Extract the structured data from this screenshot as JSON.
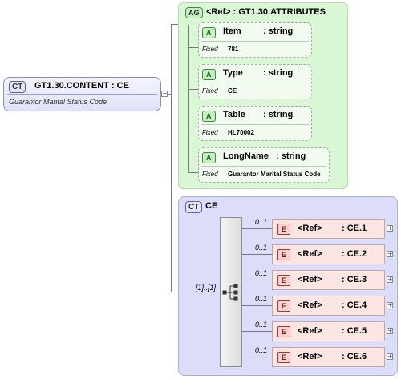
{
  "root": {
    "badge": "CT",
    "title": "GT1.30.CONTENT : CE",
    "description": "Guarantor Marital Status Code"
  },
  "attributes_group": {
    "badge": "AG",
    "title": "<Ref>      : GT1.30.ATTRIBUTES",
    "fixed_label": "Fixed",
    "items": [
      {
        "badge": "A",
        "name": "Item",
        "type": ": string",
        "fixed": "781"
      },
      {
        "badge": "A",
        "name": "Type",
        "type": ": string",
        "fixed": "CE"
      },
      {
        "badge": "A",
        "name": "Table",
        "type": ": string",
        "fixed": "HL70002"
      },
      {
        "badge": "A",
        "name": "LongName",
        "type": ": string",
        "fixed": "Guarantor Marital Status Code"
      }
    ]
  },
  "complex_type": {
    "badge": "CT",
    "title": "CE",
    "sequence_occurrence": "[1]..[1]",
    "elements": [
      {
        "badge": "E",
        "ref": "<Ref>",
        "type": ": CE.1",
        "occurrence": "0..1"
      },
      {
        "badge": "E",
        "ref": "<Ref>",
        "type": ": CE.2",
        "occurrence": "0..1"
      },
      {
        "badge": "E",
        "ref": "<Ref>",
        "type": ": CE.3",
        "occurrence": "0..1"
      },
      {
        "badge": "E",
        "ref": "<Ref>",
        "type": ": CE.4",
        "occurrence": "0..1"
      },
      {
        "badge": "E",
        "ref": "<Ref>",
        "type": ": CE.5",
        "occurrence": "0..1"
      },
      {
        "badge": "E",
        "ref": "<Ref>",
        "type": ": CE.6",
        "occurrence": "0..1"
      }
    ]
  }
}
